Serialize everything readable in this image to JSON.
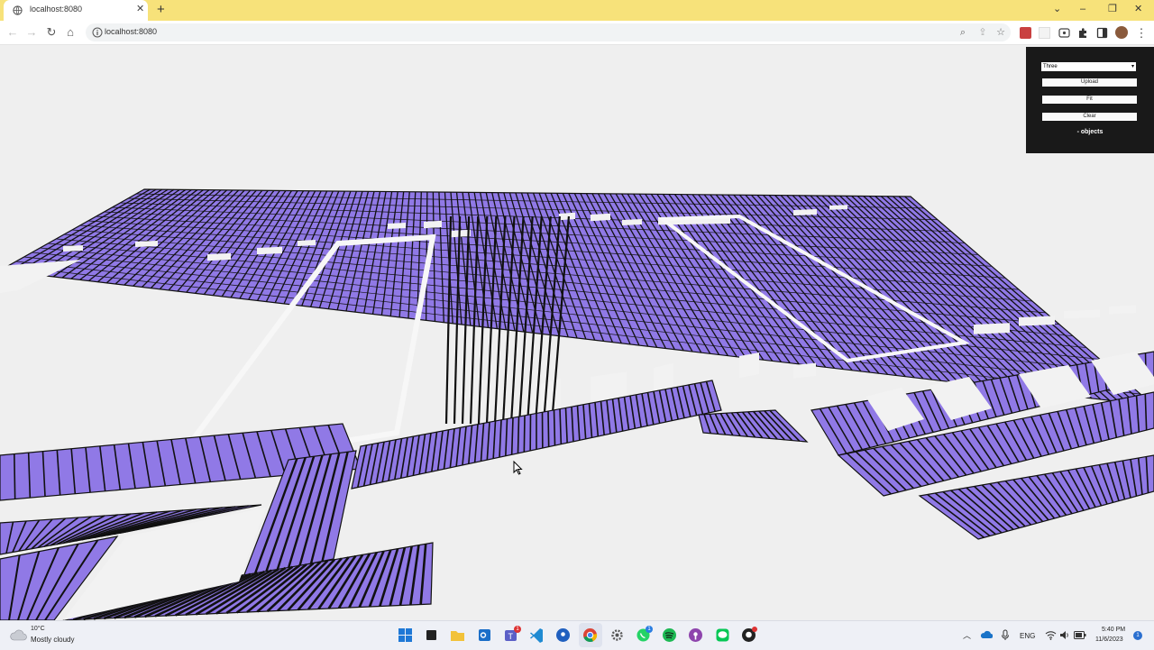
{
  "browser": {
    "tab_title": "localhost:8080",
    "tab_close": "✕",
    "new_tab": "+",
    "url": "localhost:8080",
    "window_controls": {
      "chevron": "⌄",
      "minimize": "–",
      "restore": "❐",
      "close": "✕"
    },
    "nav": {
      "back": "←",
      "forward": "→",
      "reload": "↻",
      "home": "⌂"
    },
    "omnibox_icons": {
      "zoom": "⌕",
      "share": "⇪",
      "bookmark": "☆"
    },
    "menu": "⋮"
  },
  "panel": {
    "select_value": "Three",
    "caret": "▾",
    "buttons": [
      "Upload",
      "Fit",
      "Clear"
    ],
    "folder_label": "- objects"
  },
  "scene": {
    "mesh_color": "#9079e6",
    "edge_color": "#111111",
    "background": "#efefef"
  },
  "taskbar": {
    "weather_temp": "10°C",
    "weather_desc": "Mostly cloudy",
    "language": "ENG",
    "time": "5:40 PM",
    "date": "11/6/2023",
    "badges": {
      "teams": "1",
      "whatsapp": "1"
    },
    "tray_chevron": "︿",
    "notification": "1"
  }
}
